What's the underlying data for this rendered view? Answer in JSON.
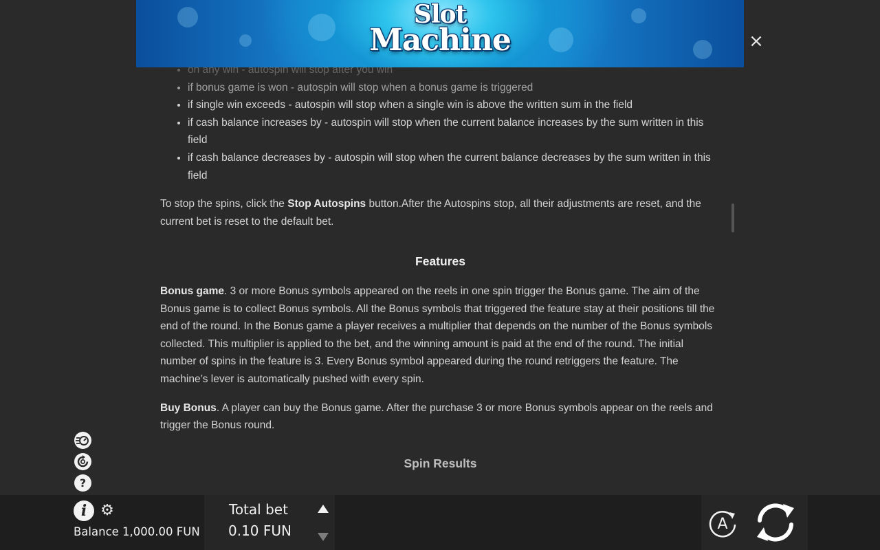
{
  "banner": {
    "logo_line1": "Slot",
    "logo_line2": "Machine"
  },
  "close_symbol": "×",
  "rules": {
    "faded_item": "on any win - autospin will stop after you win",
    "stop_items": [
      "if bonus game is won - autospin will stop when a bonus game is triggered",
      "if single win exceeds - autospin will stop when a single win is above the written sum in the field",
      "if cash balance increases by - autospin will stop when the current balance increases by the sum written in this field",
      "if cash balance decreases by - autospin will stop when the current balance decreases by the sum written in this field"
    ],
    "stop_para_pre": "To stop the spins, click the ",
    "stop_para_bold": "Stop Autospins",
    "stop_para_post": " button.After the Autospins stop, all their adjustments are reset, and the current bet is reset to the default bet."
  },
  "features": {
    "title": "Features",
    "bonus_title": "Bonus game",
    "bonus_text": ". 3 or more Bonus symbols appeared on the reels in one spin trigger the Bonus game. The aim of the Bonus game is to collect Bonus symbols. All the Bonus symbols that triggered the feature stay at their positions till the end of the round. In the Bonus game a player receives a multiplier that depends on the number of the Bonus symbols collected. This multiplier is applied to the bet, and the winning amount is paid at the end of the round. The initial number of spins in the feature is 3. Every Bonus symbol appeared during the round retriggers the feature. The machine’s lever is automatically pushed with every spin.",
    "buy_title": "Buy Bonus",
    "buy_text": ". A player can buy the Bonus game. After the purchase 3 or more Bonus symbols appear on the reels and trigger the Bonus round."
  },
  "spin_results_title": "Spin Results",
  "side_icons": [
    "turbo-icon",
    "autoplay-settings-icon",
    "help-icon"
  ],
  "help_symbol": "?",
  "bottom": {
    "info_symbol": "i",
    "gear_symbol": "⚙",
    "balance": "Balance 1,000.00 FUN",
    "total_bet_label": "Total bet",
    "total_bet_value": "0.10 FUN",
    "autoplay_letter": "A"
  }
}
